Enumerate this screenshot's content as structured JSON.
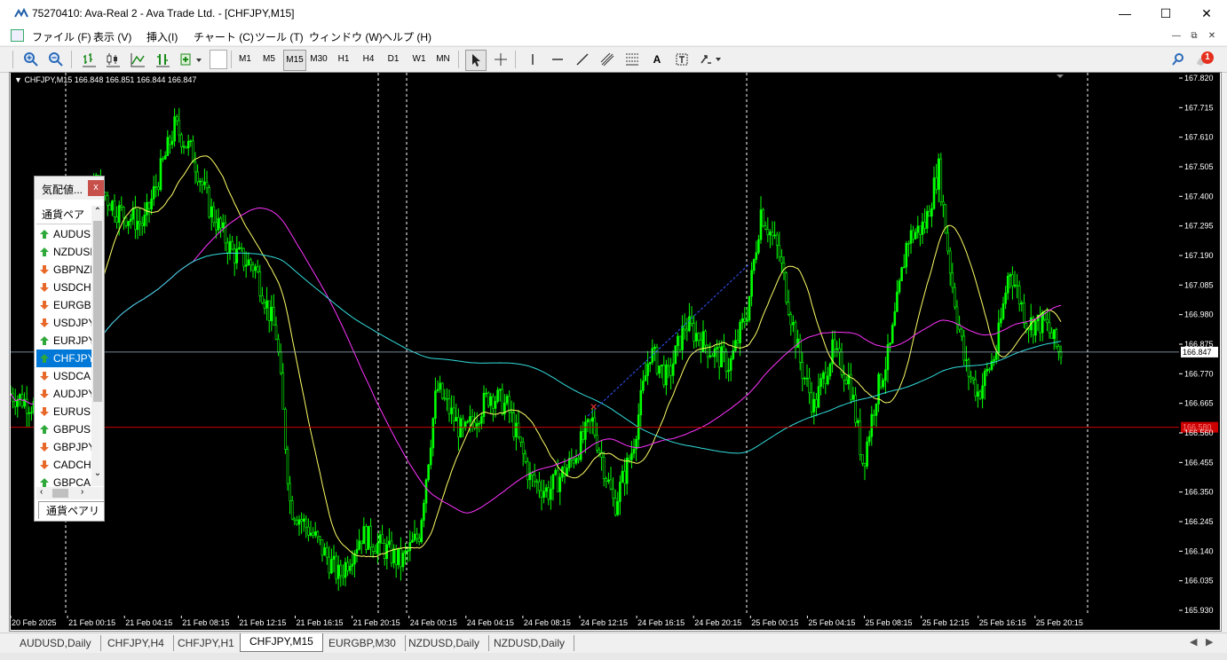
{
  "window": {
    "title": "75270410: Ava-Real 2 - Ava Trade Ltd. - [CHFJPY,M15]",
    "min_icon": "minimize-icon",
    "max_icon": "maximize-icon",
    "close_icon": "close-icon"
  },
  "menu": [
    "ファイル (F)",
    "表示 (V)",
    "挿入(I)",
    "チャート (C)",
    "ツール (T)",
    "ウィンドウ (W)",
    "ヘルプ (H)"
  ],
  "toolbar": {
    "timeframes": [
      "M1",
      "M5",
      "M15",
      "M30",
      "H1",
      "H4",
      "D1",
      "W1",
      "MN"
    ],
    "active_timeframe": "M15",
    "text_tool_label": "A",
    "notification_count": "1"
  },
  "chart": {
    "header": "CHFJPY,M15  166.848 166.851 166.844 166.847",
    "current_price": "166.847",
    "red_line_label": "166.580",
    "price_ticks": [
      "167.820",
      "167.715",
      "167.610",
      "167.505",
      "167.400",
      "167.295",
      "167.190",
      "167.085",
      "166.980",
      "166.875",
      "166.770",
      "166.665",
      "166.560",
      "166.455",
      "166.350",
      "166.245",
      "166.140",
      "166.035",
      "165.930"
    ],
    "time_ticks": [
      "20 Feb 2025",
      "21 Feb 00:15",
      "21 Feb 04:15",
      "21 Feb 08:15",
      "21 Feb 12:15",
      "21 Feb 16:15",
      "21 Feb 20:15",
      "24 Feb 00:15",
      "24 Feb 04:15",
      "24 Feb 08:15",
      "24 Feb 12:15",
      "24 Feb 16:15",
      "24 Feb 20:15",
      "25 Feb 00:15",
      "25 Feb 04:15",
      "25 Feb 08:15",
      "25 Feb 12:15",
      "25 Feb 16:15",
      "25 Feb 20:15"
    ],
    "colors": {
      "background": "#000000",
      "candles": "#00ff00",
      "ma_fast": "#ffff66",
      "ma_mid": "#ff33ff",
      "ma_slow": "#33dddd",
      "bid_line": "#cc0000",
      "axis_text": "#ffffff"
    }
  },
  "market_watch": {
    "title": "気配値...",
    "column_header": "通貨ペア",
    "rows": [
      {
        "symbol": "AUDUSD",
        "dir": "up"
      },
      {
        "symbol": "NZDUSD",
        "dir": "up"
      },
      {
        "symbol": "GBPNZD",
        "dir": "down"
      },
      {
        "symbol": "USDCHF",
        "dir": "down"
      },
      {
        "symbol": "EURGBP",
        "dir": "down"
      },
      {
        "symbol": "USDJPY",
        "dir": "down"
      },
      {
        "symbol": "EURJPY",
        "dir": "up"
      },
      {
        "symbol": "CHFJPY",
        "dir": "up",
        "selected": true
      },
      {
        "symbol": "USDCAD",
        "dir": "down"
      },
      {
        "symbol": "AUDJPY",
        "dir": "down"
      },
      {
        "symbol": "EURUSD",
        "dir": "down"
      },
      {
        "symbol": "GBPUSD",
        "dir": "up"
      },
      {
        "symbol": "GBPJPY",
        "dir": "down"
      },
      {
        "symbol": "CADCHF",
        "dir": "down"
      },
      {
        "symbol": "GBPCAD",
        "dir": "up"
      }
    ],
    "tab_label": "通貨ペアリスト"
  },
  "chart_tabs": [
    "AUDUSD,Daily",
    "CHFJPY,H4",
    "CHFJPY,H1",
    "CHFJPY,M15",
    "EURGBP,M30",
    "NZDUSD,Daily",
    "NZDUSD,Daily"
  ],
  "active_tab": "CHFJPY,M15"
}
